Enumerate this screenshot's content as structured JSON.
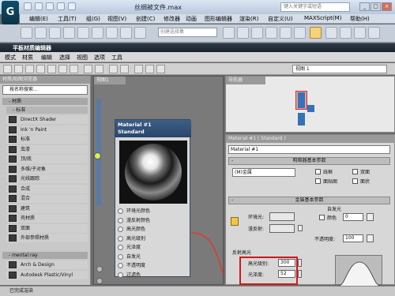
{
  "titlebar": {
    "app_logo": "G",
    "file_title": "丝绸被文件.max",
    "help_search_placeholder": "键入关键字或短语",
    "minimize": "_",
    "maximize": "□",
    "close": "×"
  },
  "menubar": {
    "items": [
      "编辑(E)",
      "工具(T)",
      "组(G)",
      "视图(V)",
      "创建(C)",
      "修改器",
      "动画",
      "图形编辑器",
      "渲染(R)",
      "自定义(U)",
      "MAXScript(M)",
      "帮助(H)"
    ]
  },
  "toolbar": {
    "selection_set_placeholder": "创建选择集"
  },
  "slate": {
    "title": "平板材质编辑器",
    "menus": [
      "模式",
      "材质",
      "编辑",
      "选择",
      "视图",
      "选项",
      "工具"
    ],
    "view_select": "视图 1"
  },
  "browser": {
    "header": "材质/贴图浏览器",
    "search_placeholder": "按名称搜索...",
    "group_materials": "- 材质",
    "sub_standard": "- 标准",
    "materials": [
      "DirectX Shader",
      "Ink 'n Paint",
      "标准",
      "虫漆",
      "顶/底",
      "多维/子对象",
      "光线跟踪",
      "合成",
      "混合",
      "建筑",
      "壳材质",
      "双面",
      "外部参照材质"
    ],
    "group_mental_ray": "- mental ray",
    "mr_materials": [
      "Arch & Design",
      "Autodesk Plastic/Vinyl"
    ]
  },
  "view1": {
    "tab": "视图1",
    "node_title_line1": "Material #1",
    "node_title_line2": "Standard",
    "slots": [
      "环境光颜色",
      "漫反射颜色",
      "高光颜色",
      "高光级别",
      "光泽度",
      "自发光",
      "不透明度",
      "过滤色"
    ]
  },
  "navigator": {
    "tab": "导航器"
  },
  "params": {
    "header": "Material #1 ( Standard )",
    "material_name": "Material #1",
    "rollout_shader": "明暗器基本参数",
    "shader_value": "(M)金属",
    "wire_label": "线框",
    "two_sided_label": "双面",
    "face_map_label": "面贴图",
    "faceted_label": "面状",
    "rollout_metal": "金属基本参数",
    "ambient_label": "环境光:",
    "diffuse_label": "漫反射:",
    "self_illum_label": "自发光",
    "color_label": "颜色",
    "self_illum_value": "0",
    "opacity_label": "不透明度:",
    "opacity_value": "100",
    "specular_group": "反射高光",
    "specular_level_label": "高光级别:",
    "specular_level_value": "300",
    "glossiness_label": "光泽度:",
    "glossiness_value": "52"
  },
  "statusbar": {
    "text": "已完成渲染"
  }
}
